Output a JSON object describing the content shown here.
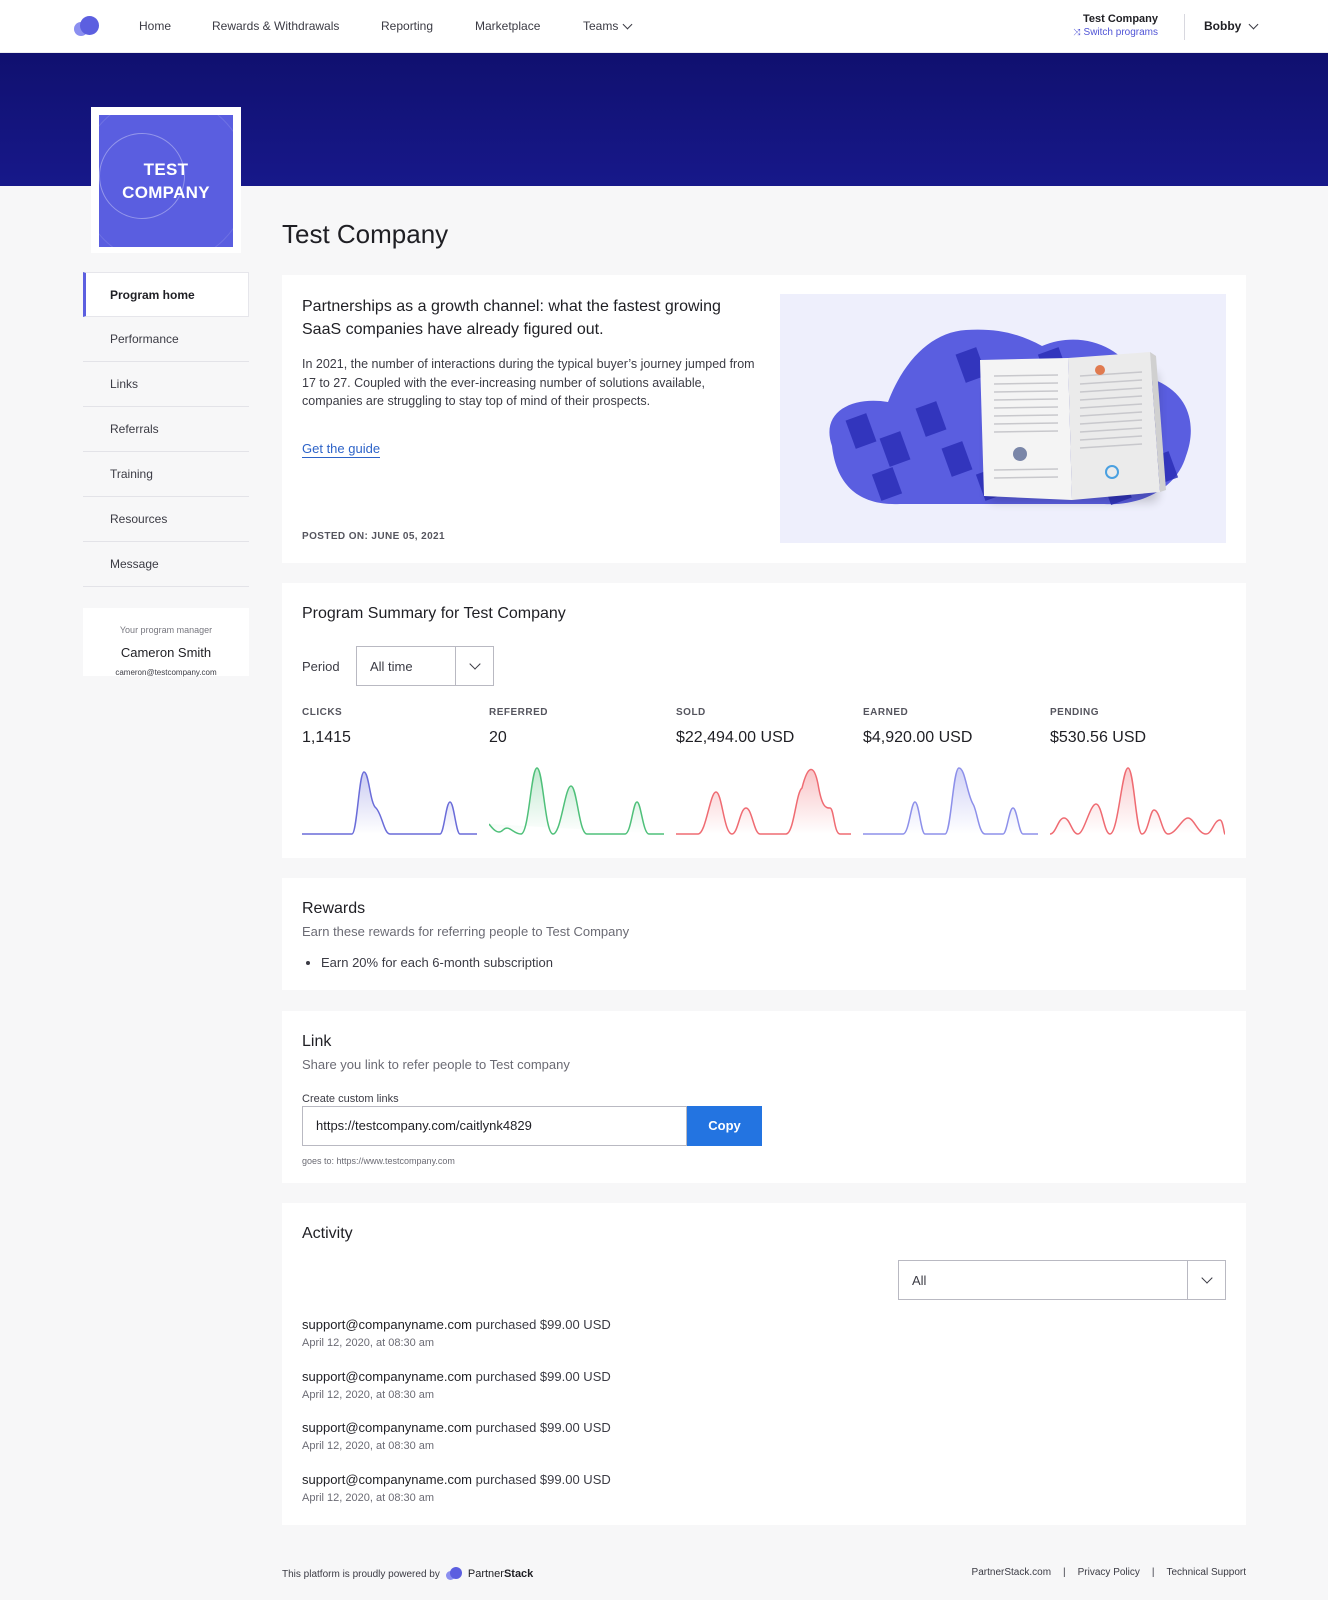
{
  "nav": {
    "items": [
      "Home",
      "Rewards & Withdrawals",
      "Reporting",
      "Marketplace",
      "Teams"
    ],
    "account_name": "Test Company",
    "switch_label": "Switch programs",
    "user": "Bobby"
  },
  "brand": {
    "logo_line1": "TEST",
    "logo_line2": "COMPANY"
  },
  "sidebar": {
    "items": [
      "Program home",
      "Performance",
      "Links",
      "Referrals",
      "Training",
      "Resources",
      "Message"
    ],
    "active": "Program home"
  },
  "manager": {
    "label": "Your program manager",
    "name": "Cameron Smith",
    "email": "cameron@testcompany.com"
  },
  "page_title": "Test Company",
  "feature": {
    "title": "Partnerships as a growth channel: what the fastest growing SaaS companies have already figured out.",
    "body": "In 2021, the number of interactions during the typical buyer’s journey jumped from 17 to 27. Coupled with the ever-increasing number of solutions available, companies are struggling to stay top of mind of their prospects.",
    "link": "Get the guide",
    "posted": "POSTED ON: JUNE 05, 2021"
  },
  "summary": {
    "title": "Program Summary for Test Company",
    "period_label": "Period",
    "period_value": "All time",
    "stats": [
      {
        "label": "CLICKS",
        "value": "1,1415",
        "color": "#6a6cd9"
      },
      {
        "label": "REFERRED",
        "value": "20",
        "color": "#4fc07a"
      },
      {
        "label": "SOLD",
        "value": "$22,494.00 USD",
        "color": "#ef6b72"
      },
      {
        "label": "EARNED",
        "value": "$4,920.00 USD",
        "color": "#8d90ea"
      },
      {
        "label": "PENDING",
        "value": "$530.56 USD",
        "color": "#ef6b72"
      }
    ]
  },
  "rewards": {
    "title": "Rewards",
    "subtitle": "Earn these rewards for referring people to Test Company",
    "items": [
      "Earn 20% for each 6-month subscription"
    ]
  },
  "link": {
    "title": "Link",
    "subtitle": "Share you link to refer people to Test company",
    "create_label": "Create custom links",
    "url": "https://testcompany.com/caitlynk4829",
    "copy_label": "Copy",
    "goes_to": "goes to: https://www.testcompany.com"
  },
  "activity": {
    "title": "Activity",
    "filter_value": "All",
    "items": [
      {
        "who": "support@companyname.com",
        "action": " purchased $99.00 USD",
        "when": "April 12, 2020, at 08:30 am"
      },
      {
        "who": "support@companyname.com",
        "action": " purchased $99.00 USD",
        "when": "April 12, 2020, at 08:30 am"
      },
      {
        "who": "support@companyname.com",
        "action": " purchased $99.00 USD",
        "when": "April 12, 2020, at 08:30 am"
      },
      {
        "who": "support@companyname.com",
        "action": " purchased $99.00 USD",
        "when": "April 12, 2020, at 08:30 am"
      }
    ]
  },
  "footer": {
    "powered": "This platform is proudly powered by",
    "brand_a": "Partner",
    "brand_b": "Stack",
    "links": [
      "PartnerStack.com",
      "Privacy Policy",
      "Technical Support"
    ]
  },
  "colors": {
    "banner": "#13137a",
    "accent": "#5c5fe0",
    "button": "#2374e1",
    "link": "#2d63c8"
  }
}
